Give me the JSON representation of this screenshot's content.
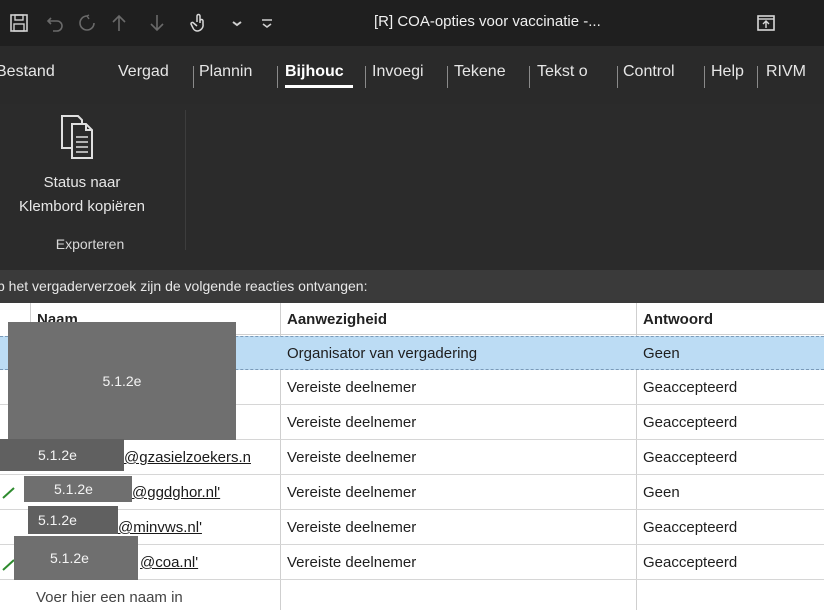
{
  "window": {
    "title": "[R] COA-opties voor vaccinatie -...",
    "icons": [
      "save-icon",
      "undo-icon",
      "redo-icon",
      "up-icon",
      "down-icon",
      "touch-icon",
      "chevron-down-icon",
      "customize-icon",
      "restore-icon"
    ]
  },
  "tabs": [
    {
      "label": "Bestand",
      "active": false
    },
    {
      "label": "Vergad",
      "active": false
    },
    {
      "label": "Plannin",
      "active": false
    },
    {
      "label": "Bijhouc",
      "active": true
    },
    {
      "label": "Invoegi",
      "active": false
    },
    {
      "label": "Tekene",
      "active": false
    },
    {
      "label": "Tekst o",
      "active": false
    },
    {
      "label": "Control",
      "active": false
    },
    {
      "label": "Help",
      "active": false
    },
    {
      "label": "RIVM",
      "active": false
    }
  ],
  "ribbon": {
    "button_line1": "Status naar",
    "button_line2": "Klembord kopiëren",
    "group_label": "Exporteren",
    "icon": "clipboard-copy-icon"
  },
  "info": {
    "text": "p het vergaderverzoek zijn de volgende reacties ontvangen:"
  },
  "table": {
    "headers": [
      "Naam",
      "Aanwezigheid",
      "Antwoord"
    ],
    "rows": [
      {
        "name": "",
        "attendance": "Organisator van vergadering",
        "response": "Geen",
        "selected": true
      },
      {
        "name": "",
        "attendance": "Vereiste deelnemer",
        "response": "Geaccepteerd",
        "selected": false
      },
      {
        "name": "",
        "attendance": "Vereiste deelnemer",
        "response": "Geaccepteerd",
        "selected": false
      },
      {
        "name": "@gzasielzoekers.n",
        "attendance": "Vereiste deelnemer",
        "response": "Geaccepteerd",
        "selected": false
      },
      {
        "name": "@ggdghor.nl'",
        "attendance": "Vereiste deelnemer",
        "response": "Geen",
        "selected": false
      },
      {
        "name": "@minvws.nl'",
        "attendance": "Vereiste deelnemer",
        "response": "Geaccepteerd",
        "selected": false
      },
      {
        "name": "@coa.nl'",
        "attendance": "Vereiste deelnemer",
        "response": "Geaccepteerd",
        "selected": false
      }
    ],
    "placeholder": "Voer hier een naam in"
  },
  "redactions": [
    "5.1.2e",
    "5.1.2e",
    "5.1.2e",
    "5.1.2e",
    "5.1.2e"
  ]
}
